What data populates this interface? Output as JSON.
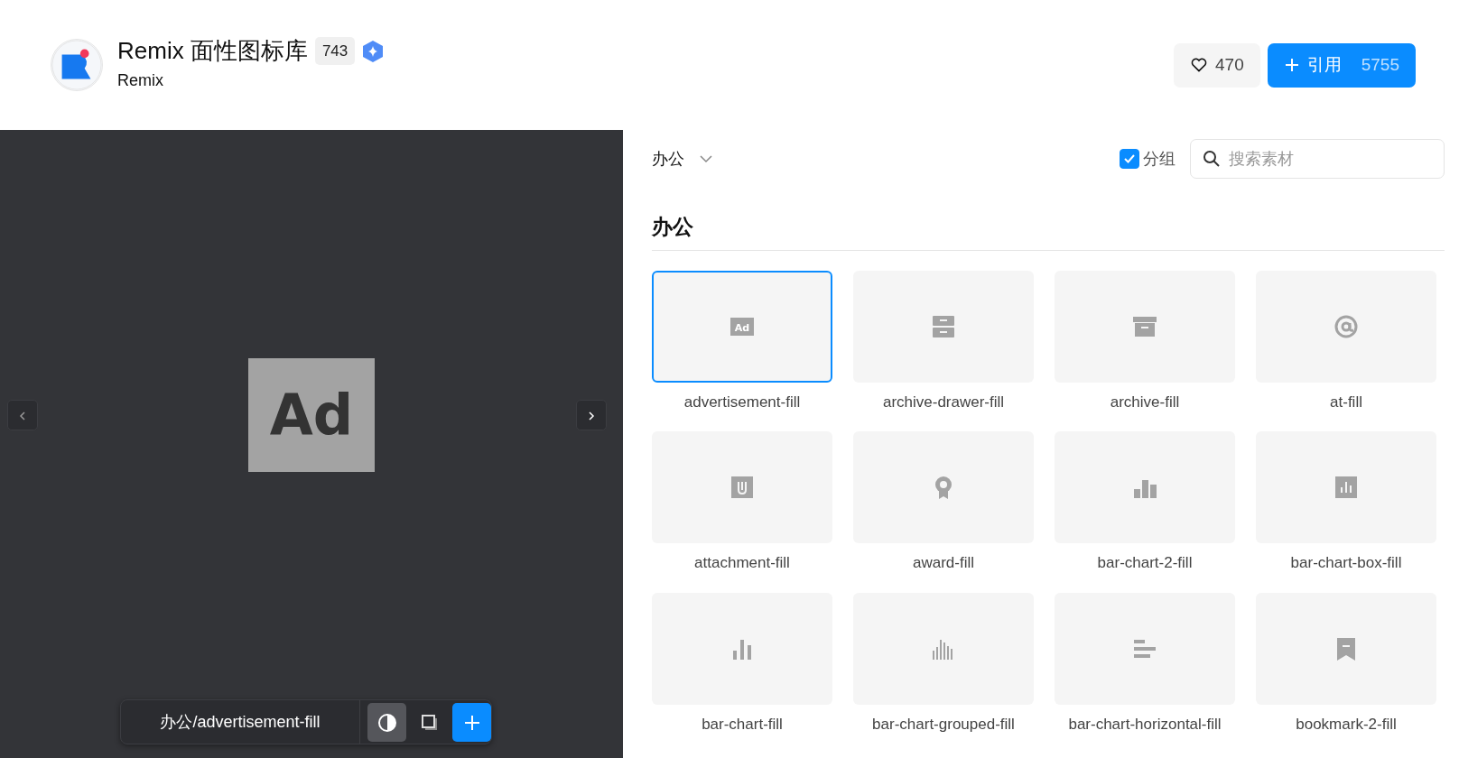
{
  "header": {
    "title": "Remix 面性图标库",
    "count": "743",
    "verified": true,
    "subtitle": "Remix",
    "like_count": "470",
    "cite_label": "引用",
    "cite_count": "5755"
  },
  "preview": {
    "icon_text": "Ad",
    "path": "办公/advertisement-fill",
    "contrast_on": true
  },
  "toolbar": {
    "category": "办公",
    "group_label": "分组",
    "group_checked": true,
    "search_placeholder": "搜索素材"
  },
  "section": {
    "title": "办公",
    "icons": [
      {
        "name": "advertisement-fill",
        "selected": true,
        "icon_text": "Ad"
      },
      {
        "name": "archive-drawer-fill",
        "selected": false
      },
      {
        "name": "archive-fill",
        "selected": false
      },
      {
        "name": "at-fill",
        "selected": false
      },
      {
        "name": "attachment-fill",
        "selected": false
      },
      {
        "name": "award-fill",
        "selected": false
      },
      {
        "name": "bar-chart-2-fill",
        "selected": false
      },
      {
        "name": "bar-chart-box-fill",
        "selected": false
      },
      {
        "name": "bar-chart-fill",
        "selected": false
      },
      {
        "name": "bar-chart-grouped-fill",
        "selected": false
      },
      {
        "name": "bar-chart-horizontal-fill",
        "selected": false
      },
      {
        "name": "bookmark-2-fill",
        "selected": false
      }
    ]
  }
}
